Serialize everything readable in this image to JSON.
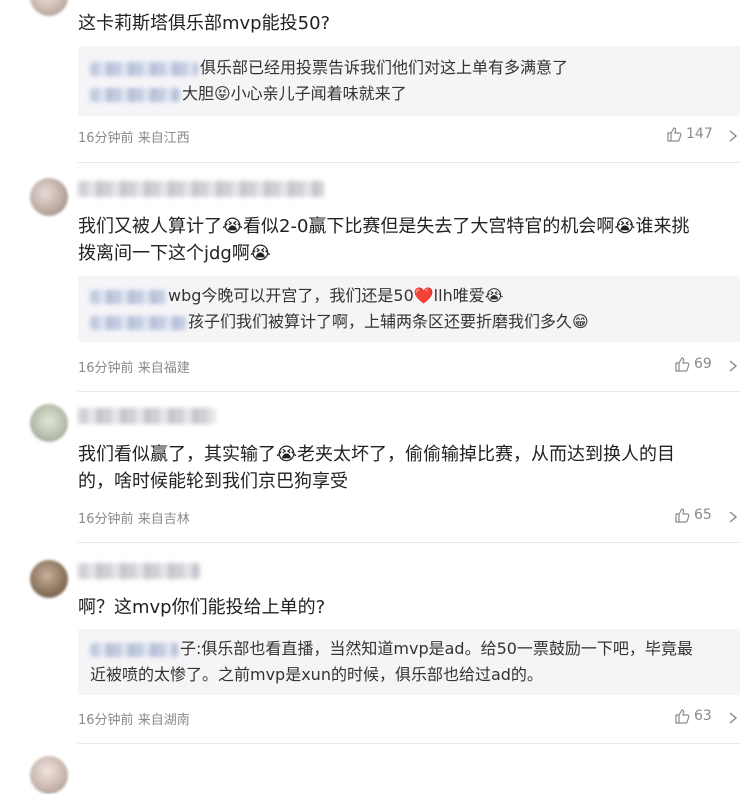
{
  "comments": [
    {
      "text": "这卡莉斯塔俱乐部mvp能投50?",
      "replies": [
        {
          "text": "俱乐部已经用投票告诉我们他们对这上单有多满意了"
        },
        {
          "text": "大胆😝小心亲儿子闻着味就来了"
        }
      ],
      "time": "16分钟前",
      "location": "来自江西",
      "likes": "147"
    },
    {
      "text_line1": "我们又被人算计了😭看似2-0赢下比赛但是失去了大宫特官的机会啊😭谁来挑",
      "text_line2": "拨离间一下这个jdg啊😭",
      "replies": [
        {
          "text": "wbg今晚可以开宫了，我们还是50❤️llh唯爱😭"
        },
        {
          "text": "孩子们我们被算计了啊，上辅两条区还要折磨我们多久😁"
        }
      ],
      "time": "16分钟前",
      "location": "来自福建",
      "likes": "69"
    },
    {
      "text_line1": "我们看似赢了，其实输了😭老夹太坏了，偷偷输掉比赛，从而达到换人的目",
      "text_line2": "的，啥时候能轮到我们京巴狗享受",
      "time": "16分钟前",
      "location": "来自吉林",
      "likes": "65"
    },
    {
      "text": "啊？这mvp你们能投给上单的?",
      "replies": [
        {
          "text": "子:俱乐部也看直播，当然知道mvp是ad。给50一票鼓励一下吧，毕竟最"
        },
        {
          "text": "近被喷的太惨了。之前mvp是xun的时候，俱乐部也给过ad的。"
        }
      ],
      "time": "16分钟前",
      "location": "来自湖南",
      "likes": "63"
    }
  ]
}
